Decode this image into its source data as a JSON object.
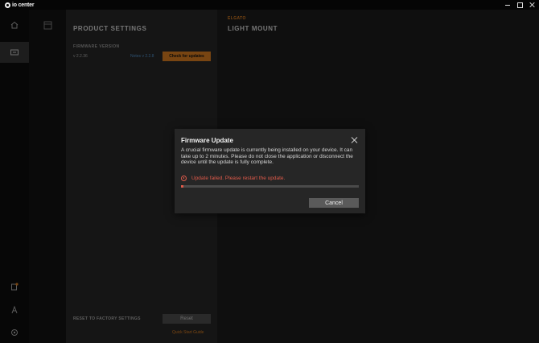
{
  "app": {
    "title": "io center"
  },
  "product_settings": {
    "title": "PRODUCT SETTINGS",
    "firmware_label": "FIRMWARE VERSION",
    "firmware_version": "v 2.2.36",
    "release_notes_link": "Notes v 2.2.8",
    "check_button": "Check for updates",
    "reset_label": "RESET TO FACTORY SETTINGS",
    "reset_button": "Reset",
    "quick_guide_link": "Quick Start Guide"
  },
  "device": {
    "brand": "ELGATO",
    "name": "LIGHT MOUNT"
  },
  "dialog": {
    "title": "Firmware Update",
    "body": "A crucial firmware update is currently being installed on your device. It can take up to 2 minutes. Please do not close the application or disconnect the device until the update is fully complete.",
    "error": "Update failed. Please restart the update.",
    "progress_fraction": 0.01,
    "cancel_button": "Cancel"
  },
  "colors": {
    "accent": "#f08a24",
    "error": "#e05a4a",
    "link": "#5aa0e0"
  },
  "icons": [
    "home-icon",
    "device-icon",
    "menu-icon",
    "notification-icon",
    "account-icon",
    "settings-icon",
    "close-icon"
  ]
}
